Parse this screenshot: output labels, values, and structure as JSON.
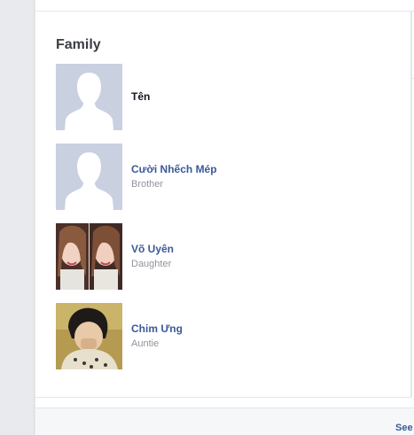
{
  "section": {
    "title": "Family"
  },
  "members": [
    {
      "name": "Tên",
      "relation": "",
      "avatar": "default-silhouette"
    },
    {
      "name": "Cười Nhếch Mép",
      "relation": "Brother",
      "avatar": "default-silhouette"
    },
    {
      "name": "Võ Uyên",
      "relation": "Daughter",
      "avatar": "profile-photo-collage"
    },
    {
      "name": "Chim Ưng",
      "relation": "Auntie",
      "avatar": "profile-photo"
    }
  ],
  "footer": {
    "see_label": "See"
  },
  "colors": {
    "link": "#3b5998",
    "text_dark": "#141823",
    "text_muted": "#90949c",
    "silhouette_bg": "#c9d0e0",
    "page_bg": "#e9eaed"
  }
}
